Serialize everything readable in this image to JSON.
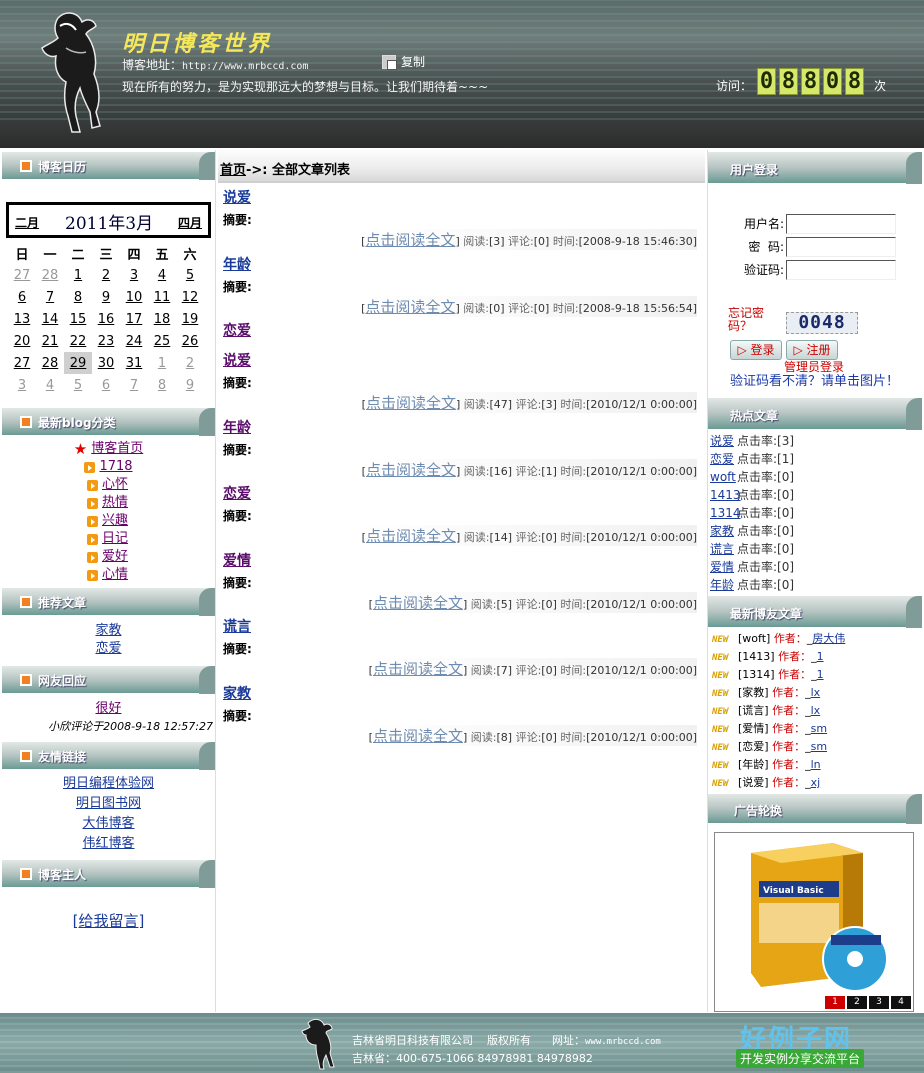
{
  "header": {
    "site_title": "明日博客世界",
    "blog_address_label": "博客地址：",
    "blog_url": "http://www.mrbccd.com",
    "copy_label": "复制",
    "motto": "现在所有的努力，是为实现那远大的梦想与目标。让我们期待着~~~",
    "visit_label": "访问：",
    "visit_digits": [
      "0",
      "8",
      "8",
      "0",
      "8"
    ],
    "visit_suffix": "次"
  },
  "left": {
    "calendar": {
      "header": "博客日历",
      "prev": "二月",
      "title": "2011年3月",
      "next": "四月",
      "weekdays": [
        "日",
        "一",
        "二",
        "三",
        "四",
        "五",
        "六"
      ],
      "rows": [
        [
          "27",
          "28",
          "1",
          "2",
          "3",
          "4",
          "5"
        ],
        [
          "6",
          "7",
          "8",
          "9",
          "10",
          "11",
          "12"
        ],
        [
          "13",
          "14",
          "15",
          "16",
          "17",
          "18",
          "19"
        ],
        [
          "20",
          "21",
          "22",
          "23",
          "24",
          "25",
          "26"
        ],
        [
          "27",
          "28",
          "29",
          "30",
          "31",
          "1",
          "2"
        ],
        [
          "3",
          "4",
          "5",
          "6",
          "7",
          "8",
          "9"
        ]
      ]
    },
    "categories": {
      "header": "最新blog分类",
      "home": "博客首页",
      "items": [
        "1718",
        "心怀",
        "热情",
        "兴趣",
        "日记",
        "爱好",
        "心情"
      ]
    },
    "recommended": {
      "header": "推荐文章",
      "items": [
        "家教",
        "恋爱"
      ]
    },
    "comments": {
      "header": "网友回应",
      "text": "很好",
      "meta": "小欣评论于2008-9-18 12:57:27"
    },
    "links": {
      "header": "友情链接",
      "items": [
        "明日编程体验网",
        "明日图书网",
        "大伟博客",
        "伟红博客"
      ]
    },
    "owner": {
      "header": "博客主人",
      "leave_message": "[给我留言]"
    }
  },
  "main": {
    "breadcrumb_home": "首页",
    "breadcrumb_sep": "->:",
    "breadcrumb_current": "全部文章列表",
    "summary_label": "摘要:",
    "read_full": "点击阅读全文",
    "read_label": "阅读:",
    "comment_label": "评论:",
    "time_label": "时间:",
    "articles": [
      {
        "title": "说爱",
        "reads": "3",
        "comments": "0",
        "time": "2008-9-18 15:46:30"
      },
      {
        "title": "年龄",
        "reads": "0",
        "comments": "0",
        "time": "2008-9-18 15:56:54"
      },
      {
        "title": "说爱",
        "reads": "47",
        "comments": "3",
        "time": "2010/12/1 0:00:00"
      },
      {
        "title": "年龄",
        "reads": "16",
        "comments": "1",
        "time": "2010/12/1 0:00:00"
      },
      {
        "title": "恋爱",
        "reads": "14",
        "comments": "0",
        "time": "2010/12/1 0:00:00"
      },
      {
        "title": "爱情",
        "reads": "5",
        "comments": "0",
        "time": "2010/12/1 0:00:00"
      },
      {
        "title": "谎言",
        "reads": "7",
        "comments": "0",
        "time": "2010/12/1 0:00:00"
      },
      {
        "title": "家教",
        "reads": "8",
        "comments": "0",
        "time": "2010/12/1 0:00:00"
      }
    ],
    "standalone_title": "恋爱"
  },
  "right": {
    "login": {
      "header": "用户登录",
      "username_label": "用户名:",
      "password_label": "密  码:",
      "captcha_label": "验证码:",
      "forgot": "忘记密码？",
      "captcha_text": "0048",
      "login_btn": "登录",
      "register_btn": "注册",
      "admin_login": "管理员登录",
      "captcha_hint": "验证码看不清？请单击图片！"
    },
    "hot": {
      "header": "热点文章",
      "click_label": "点击率:",
      "items": [
        {
          "title": "说爱",
          "count": "[3]"
        },
        {
          "title": "恋爱",
          "count": "[1]"
        },
        {
          "title": "woft",
          "count": "[0]"
        },
        {
          "title": "1413",
          "count": "[0]"
        },
        {
          "title": "1314",
          "count": "[0]"
        },
        {
          "title": "家教",
          "count": "[0]"
        },
        {
          "title": "谎言",
          "count": "[0]"
        },
        {
          "title": "爱情",
          "count": "[0]"
        },
        {
          "title": "年龄",
          "count": "[0]"
        }
      ]
    },
    "latest": {
      "header": "最新博友文章",
      "new_badge": "NEW",
      "author_label": "作者：",
      "items": [
        {
          "title": "[woft]",
          "author": "房大伟"
        },
        {
          "title": "[1413]",
          "author": "1"
        },
        {
          "title": "[1314]",
          "author": "1"
        },
        {
          "title": "[家教]",
          "author": "lx"
        },
        {
          "title": "[谎言]",
          "author": "lx"
        },
        {
          "title": "[爱情]",
          "author": "sm"
        },
        {
          "title": "[恋爱]",
          "author": "sm"
        },
        {
          "title": "[年龄]",
          "author": "ln"
        },
        {
          "title": "[说爱]",
          "author": "xj"
        }
      ]
    },
    "ads": {
      "header": "广告轮换",
      "pages": [
        "1",
        "2",
        "3",
        "4"
      ],
      "active_page": "1"
    }
  },
  "footer": {
    "company": "吉林省明日科技有限公司",
    "rights": "版权所有",
    "site_label": "网址：",
    "site_url": "www.mrbccd.com",
    "phone": "吉林省：400-675-1066   84978981 84978982"
  },
  "watermark": {
    "brand": "好例子网",
    "slogan": "开发实例分享交流平台"
  },
  "colors": {
    "article_title_visited": "#5a0d6a",
    "article_title_new": "#1a3a9a",
    "read_link": "#6e8cb0",
    "author_red": "#cc0000",
    "counter_bg": "#d6e86a"
  }
}
